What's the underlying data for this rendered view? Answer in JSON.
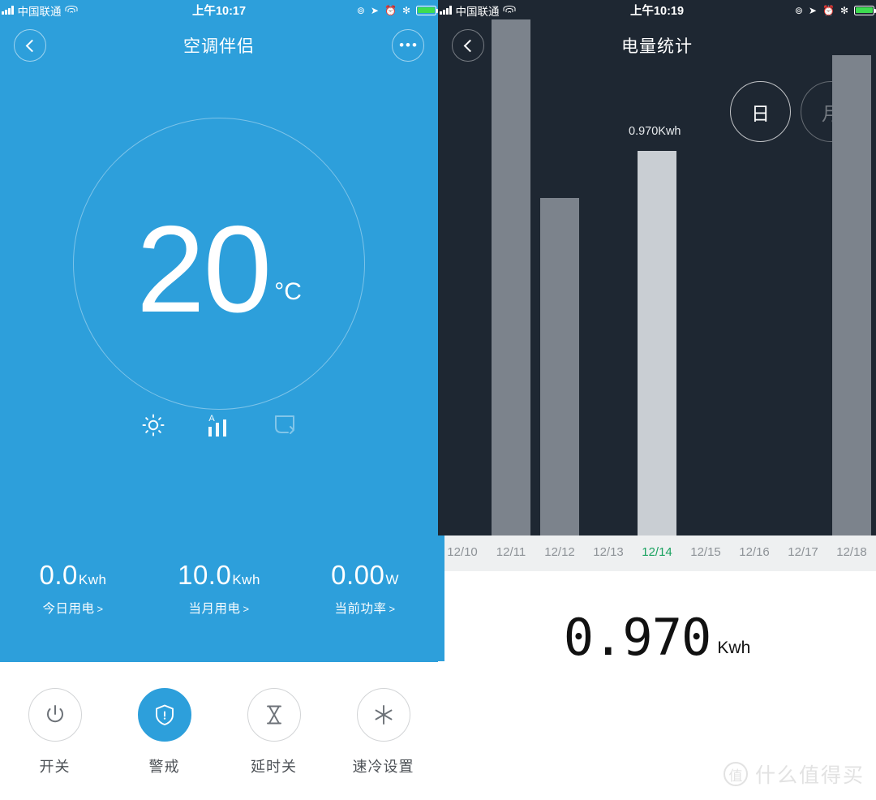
{
  "left": {
    "status": {
      "carrier": "中国联通",
      "time": "上午10:17",
      "icons": [
        "signal-icon",
        "wifi-icon",
        "rotation-lock-icon",
        "location-icon",
        "alarm-icon",
        "bluetooth-icon",
        "battery-icon"
      ]
    },
    "nav": {
      "title": "空调伴侣",
      "back": "back-icon",
      "more": "•••"
    },
    "dial": {
      "temperature": "20",
      "unit": "°C"
    },
    "modes": [
      {
        "name": "mode-heat-icon",
        "state": "active"
      },
      {
        "name": "fan-speed-auto-icon",
        "state": "active",
        "label": "A"
      },
      {
        "name": "swing-icon",
        "state": "dimmed"
      }
    ],
    "stats": [
      {
        "value": "0.0",
        "unit": "Kwh",
        "label": "今日用电",
        "arrow": ">"
      },
      {
        "value": "10.0",
        "unit": "Kwh",
        "label": "当月用电",
        "arrow": ">"
      },
      {
        "value": "0.00",
        "unit": "W",
        "label": "当前功率",
        "arrow": ">"
      }
    ],
    "actions": [
      {
        "icon": "power-icon",
        "label": "开关",
        "active": false
      },
      {
        "icon": "shield-icon",
        "label": "警戒",
        "active": true
      },
      {
        "icon": "hourglass-icon",
        "label": "延时关",
        "active": false
      },
      {
        "icon": "snowflake-icon",
        "label": "速冷设置",
        "active": false
      }
    ]
  },
  "right": {
    "status": {
      "carrier": "中国联通",
      "time": "上午10:19",
      "icons": [
        "signal-icon",
        "wifi-icon",
        "rotation-lock-icon",
        "location-icon",
        "alarm-icon",
        "bluetooth-icon",
        "battery-icon"
      ]
    },
    "nav": {
      "title": "电量统计",
      "back": "back-icon"
    },
    "period": [
      {
        "label": "日",
        "selected": true
      },
      {
        "label": "月",
        "selected": false
      }
    ],
    "tooltip": "0.970Kwh",
    "readout": {
      "value": "0.970",
      "unit": "Kwh"
    }
  },
  "watermark": {
    "mark": "值",
    "text": "什么值得买"
  },
  "colors": {
    "blue": "#2d9fdb",
    "dark": "#1e2732",
    "bar": "#7c838c",
    "bar_selected": "#c9ced3",
    "axis_band": "#eef0f1",
    "highlight_green": "#1aa260",
    "battery_green": "#3ddc50"
  },
  "chart_data": {
    "type": "bar",
    "title": "电量统计",
    "xlabel": "",
    "ylabel": "Kwh",
    "unit": "Kwh",
    "grid": false,
    "legend": false,
    "ylim": [
      0,
      1.35
    ],
    "categories": [
      "12/10",
      "12/11",
      "12/12",
      "12/13",
      "12/14",
      "12/15",
      "12/16",
      "12/17",
      "12/18"
    ],
    "values": [
      0,
      1.3,
      0.85,
      0,
      0.97,
      0,
      0,
      0,
      1.21
    ],
    "selected_index": 4,
    "selected_label": "12/14",
    "selected_value": "0.970",
    "annotations": [
      {
        "index": 4,
        "text": "0.970Kwh"
      }
    ]
  }
}
